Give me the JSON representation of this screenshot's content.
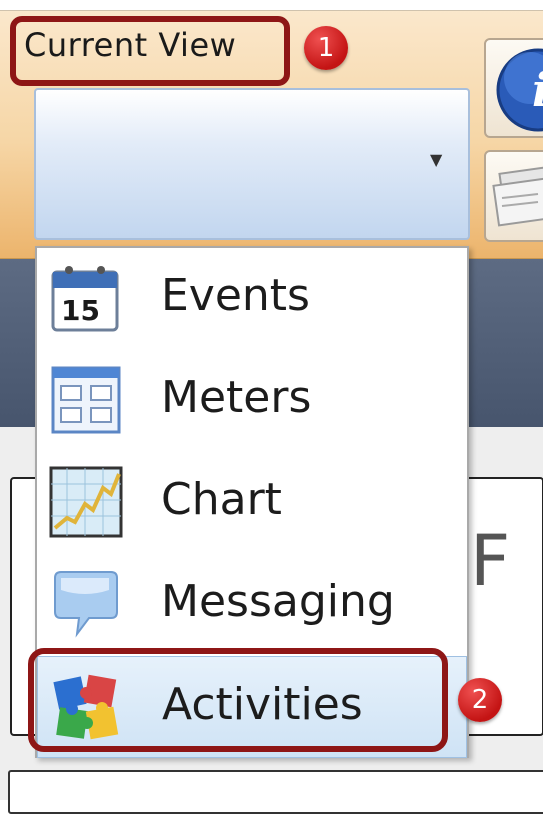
{
  "current_view": {
    "label": "Current View",
    "selected_value": ""
  },
  "menu": {
    "items": [
      {
        "label": "Events",
        "icon": "calendar-icon"
      },
      {
        "label": "Meters",
        "icon": "meters-grid-icon"
      },
      {
        "label": "Chart",
        "icon": "line-chart-icon"
      },
      {
        "label": "Messaging",
        "icon": "speech-bubble-icon"
      },
      {
        "label": "Activities",
        "icon": "puzzle-icon"
      }
    ],
    "highlighted_index": 4
  },
  "ribbon_buttons": [
    {
      "icon": "info-icon"
    },
    {
      "icon": "document-icon"
    }
  ],
  "annotations": [
    {
      "number": "1",
      "color": "#c41414"
    },
    {
      "number": "2",
      "color": "#c41414"
    }
  ],
  "colors": {
    "ribbon": "#f6d6a6",
    "highlight_border": "#8e1616",
    "selection": "#cfe3f5"
  }
}
